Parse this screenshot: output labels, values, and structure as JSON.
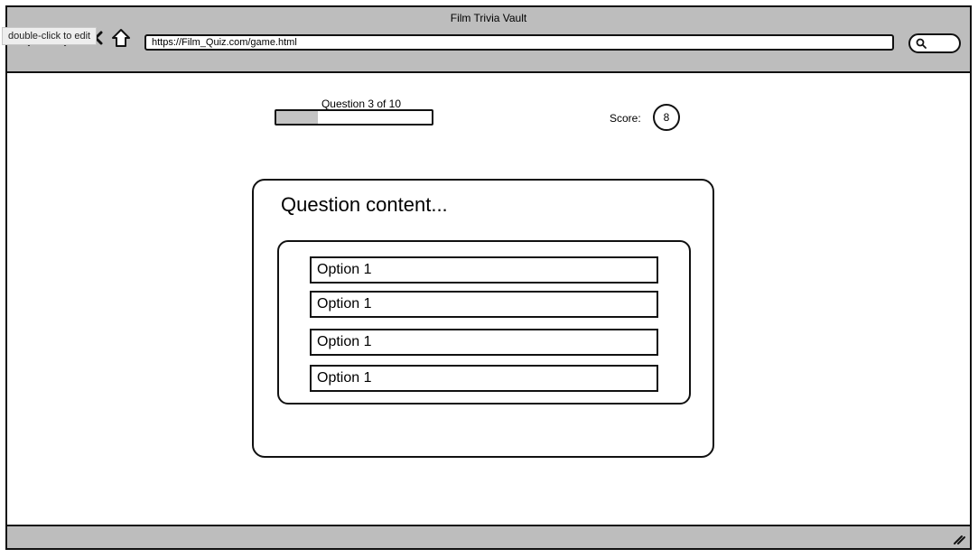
{
  "window": {
    "title": "Film Trivia Vault",
    "url": "https://Film_Quiz.com/game.html",
    "tooltip": "double-click to edit"
  },
  "nav": {
    "icons": [
      "back-arrow-icon",
      "forward-arrow-icon",
      "close-x-icon",
      "home-icon"
    ],
    "search_icon": "search-icon"
  },
  "quiz": {
    "question_counter": "Question 3 of 10",
    "progress_fraction": 0.27,
    "score_label": "Score:",
    "score_value": "8",
    "question_text": "Question content...",
    "options": [
      "Option 1",
      "Option 1",
      "Option 1",
      "Option 1"
    ]
  },
  "colors": {
    "chrome": "#bdbdbd",
    "progress_fill": "#c4c4c4",
    "stroke": "#111111"
  }
}
